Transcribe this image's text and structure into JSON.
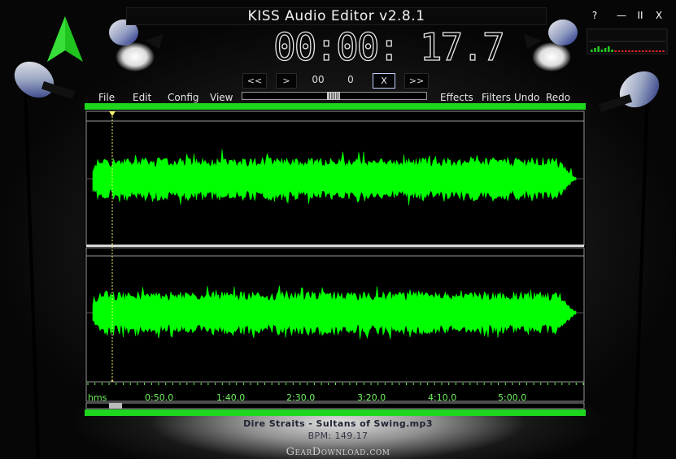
{
  "app": {
    "title": "KISS Audio Editor v2.8.1",
    "time_display": "00:00: 17.7"
  },
  "window_controls": {
    "help": "?",
    "minimize": "—",
    "pause": "II",
    "close": "X"
  },
  "transport": {
    "rewind_label": "<<",
    "play_label": ">",
    "minutes_value": "00",
    "seconds_value": "0",
    "stop_label": "X",
    "forward_label": ">>"
  },
  "menu": {
    "file": "File",
    "edit": "Edit",
    "config": "Config",
    "view": "View",
    "effects": "Effects",
    "filters": "Filters",
    "undo": "Undo",
    "redo": "Redo"
  },
  "timeline": {
    "unit_label": "hms",
    "ticks": [
      "0:50.0",
      "1:40.0",
      "2:30.0",
      "3:20.0",
      "4:10.0",
      "5:00.0"
    ]
  },
  "status": {
    "file_name": "Dire Straits - Sultans of Swing.mp3",
    "bpm": "BPM: 149.17"
  },
  "watermark": "GearDownload.com",
  "colors": {
    "waveform": "#00ff00",
    "bar_green": "#1fd61f",
    "logo_green": "#1fc41f",
    "vu_green": "#22c522",
    "vu_red": "#d42020",
    "timeline_text": "#6cf05a"
  },
  "icons": {
    "logo": "green-arrow-icon",
    "spotlights": "spotlight-icon"
  }
}
